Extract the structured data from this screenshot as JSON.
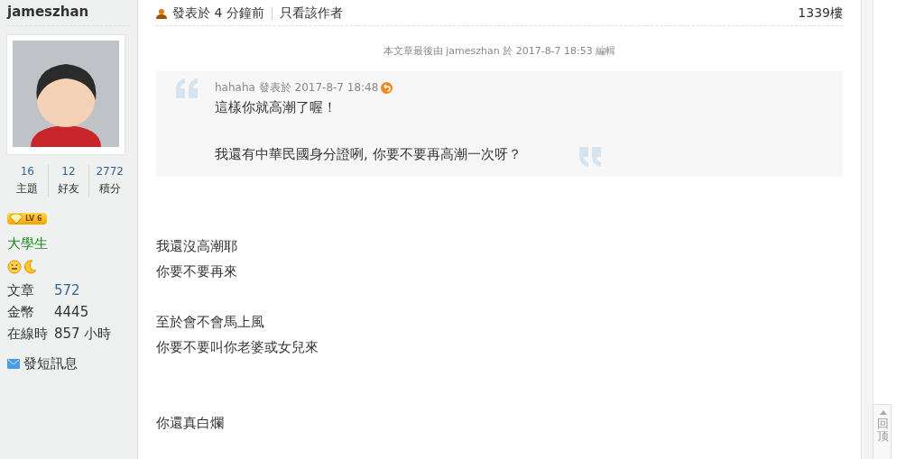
{
  "author": {
    "username": "jameszhan",
    "stats": [
      {
        "value": "16",
        "label": "主題"
      },
      {
        "value": "12",
        "label": "好友"
      },
      {
        "value": "2772",
        "label": "積分"
      }
    ],
    "level_badge": "LV 6",
    "rank": "大學生",
    "details": [
      {
        "label": "文章",
        "value": "572",
        "kind": "link"
      },
      {
        "label": "金幣",
        "value": "4445",
        "kind": "plain"
      },
      {
        "label": "在線時",
        "value": "857 小時",
        "kind": "plain"
      }
    ],
    "message_link": "發短訊息"
  },
  "post": {
    "posted": "發表於 4 分鐘前",
    "author_only": "只看該作者",
    "floor": "1339樓",
    "edit_note": "本文章最後由 jameszhan 於 2017-8-7 18:53 編輯",
    "quote": {
      "meta": "hahaha 發表於 2017-8-7 18:48",
      "paragraphs": [
        "這樣你就高潮了喔！",
        "我還有中華民國身分證咧, 你要不要再高潮一次呀？"
      ]
    },
    "body": [
      [
        "我還沒高潮耶",
        "你要不要再來"
      ],
      [
        "至於會不會馬上風",
        "你要不要叫你老婆或女兒來"
      ],
      [
        "你還真白爛"
      ]
    ]
  },
  "back_to_top": "回顶"
}
